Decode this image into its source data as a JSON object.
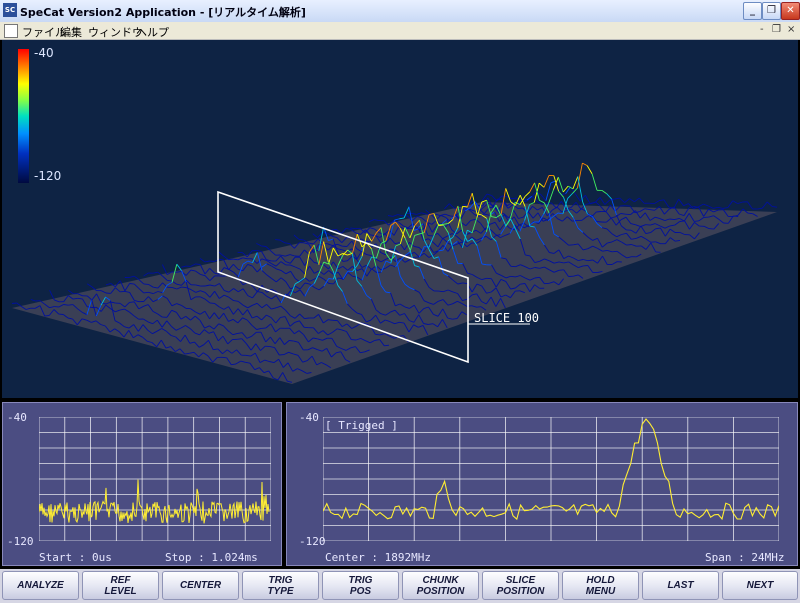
{
  "window": {
    "title": "SpeCat Version2 Application - [リアルタイム解析]",
    "app_icon": "SC",
    "minimize": "_",
    "restore": "❐",
    "close": "✕"
  },
  "menu": {
    "items": [
      "ファイル",
      "編集",
      "ウィンドウ",
      "ヘルプ"
    ],
    "mdi_min": "-",
    "mdi_restore": "❐",
    "mdi_close": "×"
  },
  "spectrogram": {
    "scale_top": "-40",
    "scale_bottom": "-120",
    "slice_label": "SLICE 100"
  },
  "time_panel": {
    "y_top": "-40",
    "y_bottom": "-120",
    "start": "Start : 0us",
    "stop": "Stop : 1.024ms"
  },
  "freq_panel": {
    "y_top": "-40",
    "y_bottom": "-120",
    "trig": "[ Trigged ]",
    "center": "Center : 1892MHz",
    "span": "Span : 24MHz"
  },
  "buttons": [
    {
      "label": "ANALYZE"
    },
    {
      "label": "REF\nLEVEL"
    },
    {
      "label": "CENTER"
    },
    {
      "label": "TRIG\nTYPE"
    },
    {
      "label": "TRIG\nPOS"
    },
    {
      "label": "CHUNK\nPOSITION"
    },
    {
      "label": "SLICE\nPOSITION"
    },
    {
      "label": "HOLD\nMENU"
    },
    {
      "label": "LAST"
    },
    {
      "label": "NEXT"
    }
  ],
  "colors": {
    "trace": "#ffee33",
    "grid": "#ffffff",
    "panel_bg": "#4b4d82",
    "plot_bg": "#0e2344"
  }
}
